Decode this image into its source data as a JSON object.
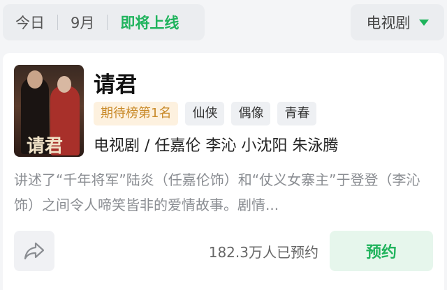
{
  "filter": {
    "tabs": [
      {
        "label": "今日"
      },
      {
        "label": "9月"
      },
      {
        "label": "即将上线"
      }
    ],
    "category": "电视剧",
    "accent_color": "#1fb35c"
  },
  "show": {
    "poster_text": "请君",
    "title": "请君",
    "rank_tag": "期待榜第1名",
    "tags": [
      "仙侠",
      "偶像",
      "青春"
    ],
    "meta": "电视剧 / 任嘉伦 李沁 小沈阳 朱泳腾",
    "description": "讲述了“千年将军”陆炎（任嘉伦饰）和“仗义女寨主”于登登（李沁饰）之间令人啼笑皆非的爱情故事。剧情...",
    "reservation_count": "182.3万人已预约",
    "reserve_label": "预约"
  }
}
